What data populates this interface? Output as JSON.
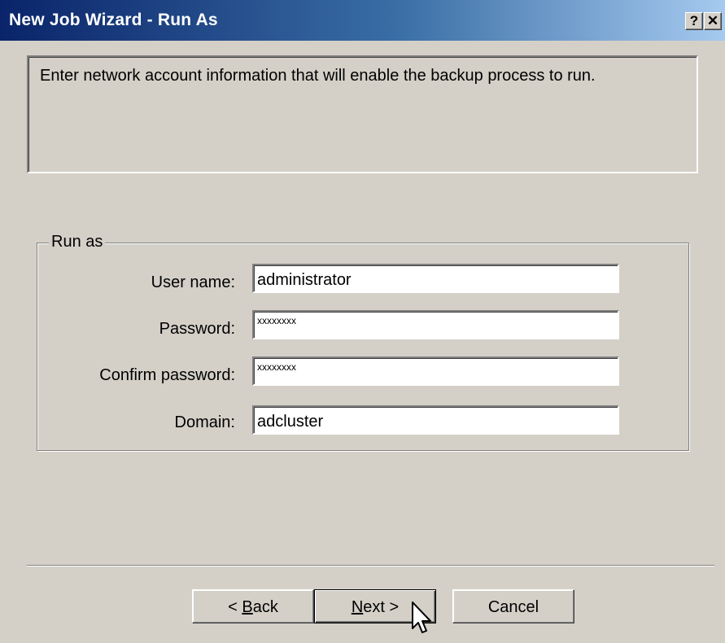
{
  "window": {
    "title": "New Job Wizard - Run As",
    "help_icon": "question-mark",
    "close_icon": "close-x"
  },
  "description": "Enter network account information that will enable the backup process to run.",
  "group": {
    "legend": "Run as",
    "fields": [
      {
        "label": "User name:",
        "value": "administrator"
      },
      {
        "label": "Password:",
        "value": "xxxxxxxx"
      },
      {
        "label": "Confirm password:",
        "value": "xxxxxxxx"
      },
      {
        "label": "Domain:",
        "value": "adcluster"
      }
    ]
  },
  "buttons": {
    "back": {
      "prefix": "< ",
      "accel": "B",
      "rest": "ack"
    },
    "next": {
      "accel": "N",
      "rest": "ext >"
    },
    "cancel": "Cancel"
  },
  "colors": {
    "title_gradient_start": "#0a246a",
    "title_gradient_end": "#a6caf0",
    "dialog_face": "#d4d0c8"
  }
}
